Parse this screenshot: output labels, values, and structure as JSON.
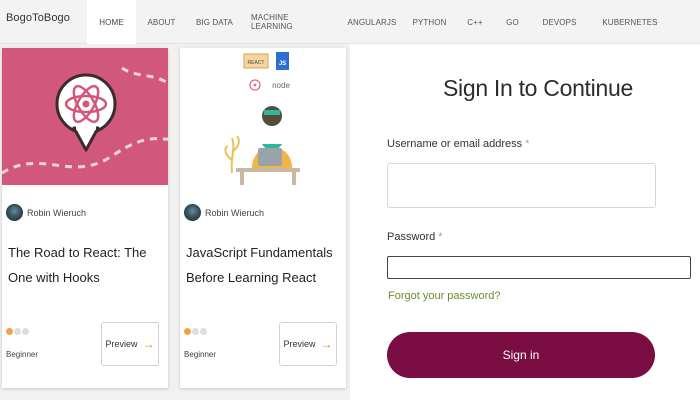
{
  "nav": {
    "brand": "BogoToBogo",
    "items": [
      {
        "label": "HOME"
      },
      {
        "label": "ABOUT"
      },
      {
        "label": "BIG DATA"
      },
      {
        "label": "MACHINE LEARNING"
      },
      {
        "label": "ANGULARJS"
      },
      {
        "label": "PYTHON"
      },
      {
        "label": "C++"
      },
      {
        "label": "GO"
      },
      {
        "label": "DEVOPS"
      },
      {
        "label": "KUBERNETES"
      }
    ]
  },
  "cards": [
    {
      "author": "Robin Wieruch",
      "title": "The Road to React: The One with Hooks",
      "level": "Beginner",
      "preview_label": "Preview",
      "level_dots_filled": 1,
      "level_dots_total": 3
    },
    {
      "author": "Robin Wieruch",
      "title": "JavaScript Fundamentals Before Learning React",
      "level": "Beginner",
      "preview_label": "Preview",
      "level_dots_filled": 1,
      "level_dots_total": 3
    }
  ],
  "card_images": {
    "card2_tags": [
      "REACT",
      "JS",
      "node"
    ]
  },
  "form": {
    "title": "Sign In to Continue",
    "username_label": "Username or email address",
    "password_label": "Password",
    "required_mark": "*",
    "username_value": "",
    "password_value": "",
    "forgot_link": "Forgot your password?",
    "submit_label": "Sign in"
  },
  "colors": {
    "accent": "#7a0d42",
    "link": "#6e8c2e",
    "react_card_bg": "#d2577d",
    "level_dot": "#f2a444"
  },
  "icons": {
    "preview_arrow": "arrow-right-icon",
    "react_logo": "react-logo-icon"
  }
}
